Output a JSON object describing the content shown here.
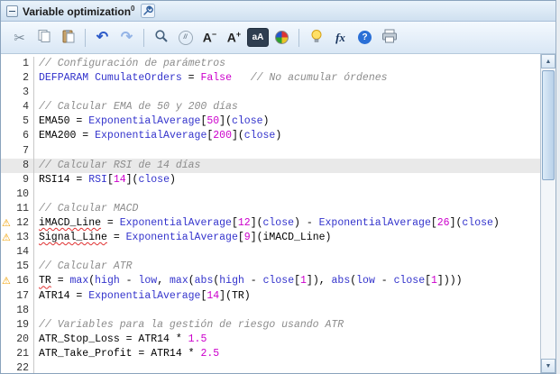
{
  "header": {
    "title": "Variable optimization",
    "superscript": "0"
  },
  "toolbar": {
    "cut_glyph": "✂",
    "undo_glyph": "↶",
    "redo_glyph": "↷",
    "comment_label": "//",
    "font_decrease": {
      "base": "A",
      "sign": "−"
    },
    "font_increase": {
      "base": "A",
      "sign": "+"
    },
    "font_style_label": "aA",
    "fx_label": "fx",
    "help_label": "?"
  },
  "scrollbar": {
    "up": "▲",
    "down": "▼"
  },
  "colors": {
    "keyword": "#3333cc",
    "number": "#cc00cc",
    "comment": "#8c8c8c",
    "error_underline": "#e03030",
    "warning": "#f0a000"
  },
  "code": {
    "highlighted_line": 8,
    "warning_lines": [
      12,
      13,
      16
    ],
    "lines": [
      {
        "n": 1,
        "tokens": [
          {
            "c": "cm",
            "t": "// Configuración de parámetros"
          }
        ]
      },
      {
        "n": 2,
        "tokens": [
          {
            "c": "kw",
            "t": "DEFPARAM"
          },
          {
            "c": "pl",
            "t": " "
          },
          {
            "c": "kw",
            "t": "CumulateOrders"
          },
          {
            "c": "pl",
            "t": " = "
          },
          {
            "c": "nm",
            "t": "False"
          },
          {
            "c": "pl",
            "t": "   "
          },
          {
            "c": "cm",
            "t": "// No acumular órdenes"
          }
        ]
      },
      {
        "n": 3,
        "tokens": []
      },
      {
        "n": 4,
        "tokens": [
          {
            "c": "cm",
            "t": "// Calcular EMA de 50 y 200 días"
          }
        ]
      },
      {
        "n": 5,
        "tokens": [
          {
            "c": "pl",
            "t": "EMA50 = "
          },
          {
            "c": "kw",
            "t": "ExponentialAverage"
          },
          {
            "c": "pl",
            "t": "["
          },
          {
            "c": "nm",
            "t": "50"
          },
          {
            "c": "pl",
            "t": "]("
          },
          {
            "c": "kw",
            "t": "close"
          },
          {
            "c": "pl",
            "t": ")"
          }
        ]
      },
      {
        "n": 6,
        "tokens": [
          {
            "c": "pl",
            "t": "EMA200 = "
          },
          {
            "c": "kw",
            "t": "ExponentialAverage"
          },
          {
            "c": "pl",
            "t": "["
          },
          {
            "c": "nm",
            "t": "200"
          },
          {
            "c": "pl",
            "t": "]("
          },
          {
            "c": "kw",
            "t": "close"
          },
          {
            "c": "pl",
            "t": ")"
          }
        ]
      },
      {
        "n": 7,
        "tokens": []
      },
      {
        "n": 8,
        "tokens": [
          {
            "c": "cm",
            "t": "// Calcular RSI de 14 días"
          }
        ]
      },
      {
        "n": 9,
        "tokens": [
          {
            "c": "pl",
            "t": "RSI14 = "
          },
          {
            "c": "kw",
            "t": "RSI"
          },
          {
            "c": "pl",
            "t": "["
          },
          {
            "c": "nm",
            "t": "14"
          },
          {
            "c": "pl",
            "t": "]("
          },
          {
            "c": "kw",
            "t": "close"
          },
          {
            "c": "pl",
            "t": ")"
          }
        ]
      },
      {
        "n": 10,
        "tokens": []
      },
      {
        "n": 11,
        "tokens": [
          {
            "c": "cm",
            "t": "// Calcular MACD"
          }
        ]
      },
      {
        "n": 12,
        "tokens": [
          {
            "c": "err",
            "t": "iMACD_Line"
          },
          {
            "c": "pl",
            "t": " = "
          },
          {
            "c": "kw",
            "t": "ExponentialAverage"
          },
          {
            "c": "pl",
            "t": "["
          },
          {
            "c": "nm",
            "t": "12"
          },
          {
            "c": "pl",
            "t": "]("
          },
          {
            "c": "kw",
            "t": "close"
          },
          {
            "c": "pl",
            "t": ") - "
          },
          {
            "c": "kw",
            "t": "ExponentialAverage"
          },
          {
            "c": "pl",
            "t": "["
          },
          {
            "c": "nm",
            "t": "26"
          },
          {
            "c": "pl",
            "t": "]("
          },
          {
            "c": "kw",
            "t": "close"
          },
          {
            "c": "pl",
            "t": ")"
          }
        ]
      },
      {
        "n": 13,
        "tokens": [
          {
            "c": "err",
            "t": "Signal_Line"
          },
          {
            "c": "pl",
            "t": " = "
          },
          {
            "c": "kw",
            "t": "ExponentialAverage"
          },
          {
            "c": "pl",
            "t": "["
          },
          {
            "c": "nm",
            "t": "9"
          },
          {
            "c": "pl",
            "t": "]("
          },
          {
            "c": "pl",
            "t": "iMACD_Line"
          },
          {
            "c": "pl",
            "t": ")"
          }
        ]
      },
      {
        "n": 14,
        "tokens": []
      },
      {
        "n": 15,
        "tokens": [
          {
            "c": "cm",
            "t": "// Calcular ATR"
          }
        ]
      },
      {
        "n": 16,
        "tokens": [
          {
            "c": "err",
            "t": "TR"
          },
          {
            "c": "pl",
            "t": " = "
          },
          {
            "c": "kw",
            "t": "max"
          },
          {
            "c": "pl",
            "t": "("
          },
          {
            "c": "kw",
            "t": "high"
          },
          {
            "c": "pl",
            "t": " - "
          },
          {
            "c": "kw",
            "t": "low"
          },
          {
            "c": "pl",
            "t": ", "
          },
          {
            "c": "kw",
            "t": "max"
          },
          {
            "c": "pl",
            "t": "("
          },
          {
            "c": "kw",
            "t": "abs"
          },
          {
            "c": "pl",
            "t": "("
          },
          {
            "c": "kw",
            "t": "high"
          },
          {
            "c": "pl",
            "t": " - "
          },
          {
            "c": "kw",
            "t": "close"
          },
          {
            "c": "pl",
            "t": "["
          },
          {
            "c": "nm",
            "t": "1"
          },
          {
            "c": "pl",
            "t": "]), "
          },
          {
            "c": "kw",
            "t": "abs"
          },
          {
            "c": "pl",
            "t": "("
          },
          {
            "c": "kw",
            "t": "low"
          },
          {
            "c": "pl",
            "t": " - "
          },
          {
            "c": "kw",
            "t": "close"
          },
          {
            "c": "pl",
            "t": "["
          },
          {
            "c": "nm",
            "t": "1"
          },
          {
            "c": "pl",
            "t": "])))"
          }
        ]
      },
      {
        "n": 17,
        "tokens": [
          {
            "c": "pl",
            "t": "ATR14 = "
          },
          {
            "c": "kw",
            "t": "ExponentialAverage"
          },
          {
            "c": "pl",
            "t": "["
          },
          {
            "c": "nm",
            "t": "14"
          },
          {
            "c": "pl",
            "t": "]("
          },
          {
            "c": "pl",
            "t": "TR"
          },
          {
            "c": "pl",
            "t": ")"
          }
        ]
      },
      {
        "n": 18,
        "tokens": []
      },
      {
        "n": 19,
        "tokens": [
          {
            "c": "cm",
            "t": "// Variables para la gestión de riesgo usando ATR"
          }
        ]
      },
      {
        "n": 20,
        "tokens": [
          {
            "c": "pl",
            "t": "ATR_Stop_Loss = ATR14 * "
          },
          {
            "c": "nm",
            "t": "1.5"
          }
        ]
      },
      {
        "n": 21,
        "tokens": [
          {
            "c": "pl",
            "t": "ATR_Take_Profit = ATR14 * "
          },
          {
            "c": "nm",
            "t": "2.5"
          }
        ]
      },
      {
        "n": 22,
        "tokens": []
      }
    ]
  }
}
